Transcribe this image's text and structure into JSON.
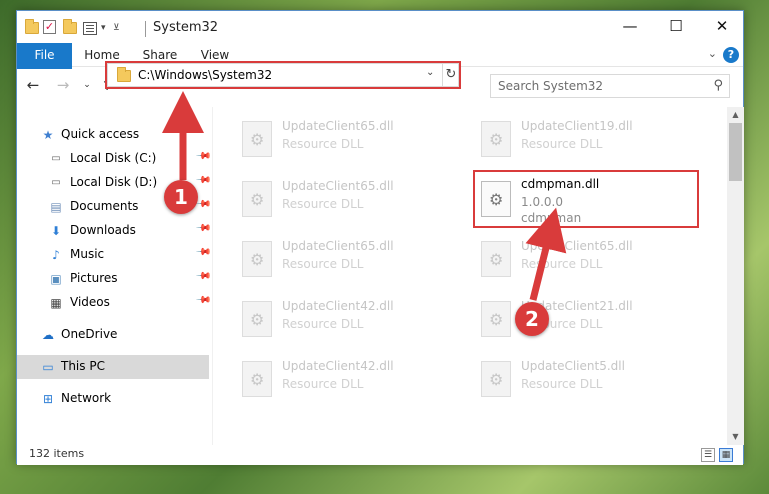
{
  "window": {
    "title": "System32",
    "controls": {
      "minimize": "—",
      "maximize": "☐",
      "close": "✕"
    }
  },
  "ribbon": {
    "tabs": [
      "File",
      "Home",
      "Share",
      "View"
    ],
    "help": "?"
  },
  "address": {
    "path": "C:\\Windows\\System32",
    "search_placeholder": "Search System32"
  },
  "sidebar": {
    "items": [
      {
        "label": "Quick access",
        "icon": "star-icon",
        "pinned": false
      },
      {
        "label": "Local Disk (C:)",
        "icon": "drive-icon",
        "pinned": true
      },
      {
        "label": "Local Disk (D:)",
        "icon": "drive-icon",
        "pinned": true
      },
      {
        "label": "Documents",
        "icon": "documents-icon",
        "pinned": true
      },
      {
        "label": "Downloads",
        "icon": "download-icon",
        "pinned": true
      },
      {
        "label": "Music",
        "icon": "music-icon",
        "pinned": true
      },
      {
        "label": "Pictures",
        "icon": "pictures-icon",
        "pinned": true
      },
      {
        "label": "Videos",
        "icon": "videos-icon",
        "pinned": true
      },
      {
        "label": "OneDrive",
        "icon": "cloud-icon",
        "pinned": false
      },
      {
        "label": "This PC",
        "icon": "computer-icon",
        "pinned": false,
        "selected": true
      },
      {
        "label": "Network",
        "icon": "network-icon",
        "pinned": false
      }
    ]
  },
  "files": {
    "left": [
      {
        "name": "UpdateClient65.dll",
        "desc": "Resource DLL"
      },
      {
        "name": "UpdateClient65.dll",
        "desc": "Resource DLL"
      },
      {
        "name": "UpdateClient65.dll",
        "desc": "Resource DLL"
      },
      {
        "name": "UpdateClient42.dll",
        "desc": "Resource DLL"
      },
      {
        "name": "UpdateClient42.dll",
        "desc": "Resource DLL"
      }
    ],
    "right": [
      {
        "name": "UpdateClient19.dll",
        "desc": "Resource DLL"
      },
      {
        "name": "UpdateClient65.dll",
        "desc": "Resource DLL"
      },
      {
        "name": "UpdateClient21.dll",
        "desc": "Resource DLL"
      },
      {
        "name": "UpdateClient5.dll",
        "desc": "Resource DLL"
      }
    ],
    "highlighted": {
      "name": "cdmpman.dll",
      "version": "1.0.0.0",
      "desc": "cdmpman"
    }
  },
  "status": {
    "item_count": "132 items"
  },
  "callouts": [
    "1",
    "2"
  ],
  "colors": {
    "accent": "#1979ca",
    "highlight": "#d93b3b"
  }
}
